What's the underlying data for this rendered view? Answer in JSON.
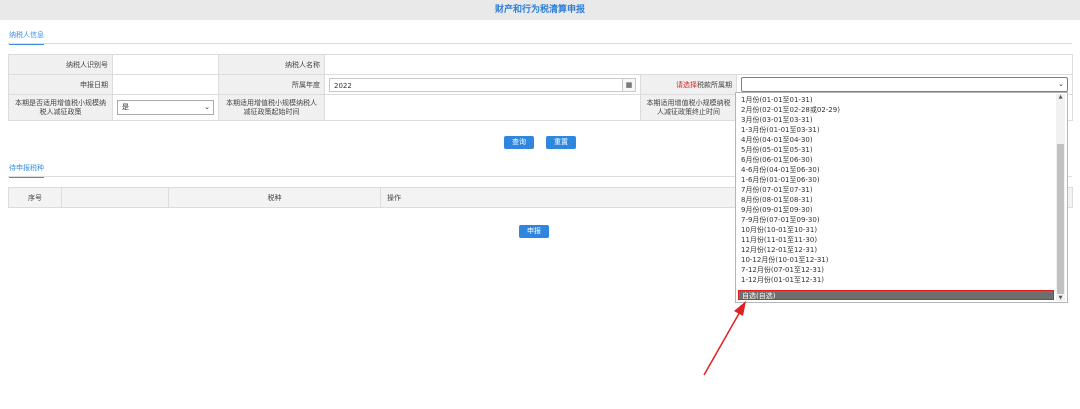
{
  "title": "财产和行为税清算申报",
  "sections": {
    "taxpayer_info": "纳税人信息",
    "pending_tax": "待申报税种"
  },
  "form": {
    "taxpayer_id_label": "纳税人识别号",
    "taxpayer_id_value": "",
    "taxpayer_name_label": "纳税人名称",
    "taxpayer_name_value": "",
    "declare_date_label": "申报日期",
    "declare_date_value": "",
    "year_label": "所属年度",
    "year_value": "2022",
    "period_label_prefix": "请选择",
    "period_label_suffix": "税款所属期",
    "period_value": "",
    "small_scale_label": "本期是否适用增值税小规模纳税人减征政策",
    "small_scale_value": "是",
    "start_time_label": "本期适用增值税小规模纳税人减征政策起始时间",
    "end_time_label": "本期适用增值税小规模纳税人减征政策终止时间"
  },
  "buttons": {
    "query": "查询",
    "reset": "重置",
    "declare": "申报"
  },
  "grid": {
    "headers": [
      "序号",
      "",
      "税种",
      "操作"
    ]
  },
  "dropdown": {
    "options": [
      "1月份(01-01至01-31)",
      "2月份(02-01至02-28或02-29)",
      "3月份(03-01至03-31)",
      "1-3月份(01-01至03-31)",
      "4月份(04-01至04-30)",
      "5月份(05-01至05-31)",
      "6月份(06-01至06-30)",
      "4-6月份(04-01至06-30)",
      "1-6月份(01-01至06-30)",
      "7月份(07-01至07-31)",
      "8月份(08-01至08-31)",
      "9月份(09-01至09-30)",
      "7-9月份(07-01至09-30)",
      "10月份(10-01至10-31)",
      "11月份(11-01至11-30)",
      "12月份(12-01至12-31)",
      "10-12月份(10-01至12-31)",
      "7-12月份(07-01至12-31)",
      "1-12月份(01-01至12-31)"
    ],
    "selected": "自选(自选)"
  },
  "colors": {
    "accent": "#2e86de",
    "title": "#2f7fd7",
    "highlight": "#e02020",
    "selected_bg": "#6f6f6f"
  }
}
